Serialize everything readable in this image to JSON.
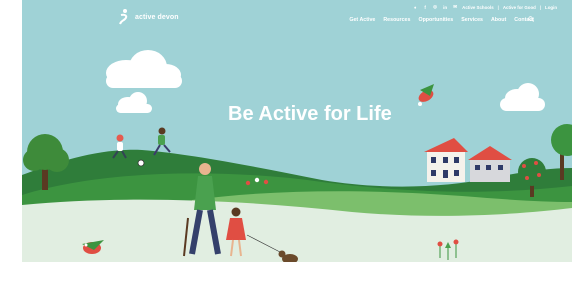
{
  "brand": {
    "name": "active devon"
  },
  "top_links": {
    "social": [
      "twitter-icon",
      "facebook-icon",
      "instagram-icon",
      "linkedin-icon",
      "email-icon"
    ],
    "active_schools": "Active Schools",
    "active_for_good": "Active for Good",
    "login": "Login",
    "separator": "|"
  },
  "nav": {
    "items": [
      "Get Active",
      "Resources",
      "Opportunities",
      "Services",
      "About",
      "Contact"
    ],
    "search_icon": "search-icon"
  },
  "hero": {
    "title": "Be Active for Life"
  },
  "colors": {
    "sky": "#9fd2d6",
    "accent": "#e65b4f",
    "grass_dark": "#2f7d3a",
    "grass_light": "#e1eee1"
  }
}
